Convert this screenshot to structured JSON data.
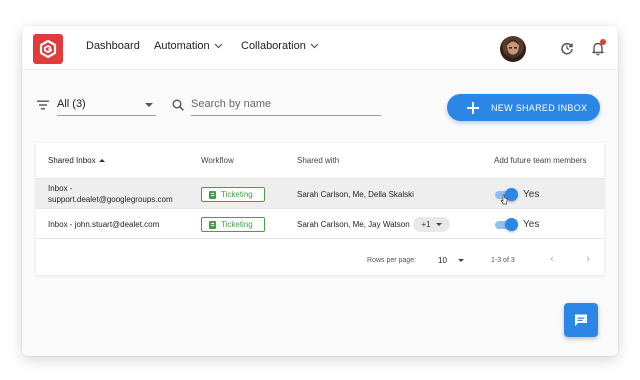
{
  "nav": {
    "dashboard": "Dashboard",
    "automation": "Automation",
    "collaboration": "Collaboration"
  },
  "filter": {
    "value": "All (3)"
  },
  "search": {
    "placeholder": "Search by name"
  },
  "actions": {
    "new_inbox_label": "NEW SHARED INBOX"
  },
  "table": {
    "columns": {
      "name": "Shared Inbox",
      "workflow": "Workflow",
      "shared_with": "Shared with",
      "add_future": "Add future team members"
    },
    "rows": [
      {
        "name_line1": "Inbox -",
        "name_line2": "support.dealet@googlegroups.com",
        "workflow": "Ticketing",
        "shared_with": "Sarah Carlson,  Me,  Della Skalski",
        "more": "",
        "toggle_on": true,
        "toggle_label": "Yes"
      },
      {
        "name_line1": "Inbox - john.stuart@dealet.com",
        "name_line2": "",
        "workflow": "Ticketing",
        "shared_with": "Sarah Carlson,  Me,  Jay Watson",
        "more": "+1",
        "toggle_on": true,
        "toggle_label": "Yes"
      }
    ],
    "footer": {
      "rows_per_page_label": "Rows per page:",
      "rows_per_page_value": "10",
      "range": "1-3 of 3",
      "prev": "‹",
      "next": "›"
    }
  },
  "colors": {
    "brand": "#e23b3b",
    "primary": "#2b86e6",
    "workflow_chip": "#43a047",
    "notification": "#e53935"
  }
}
